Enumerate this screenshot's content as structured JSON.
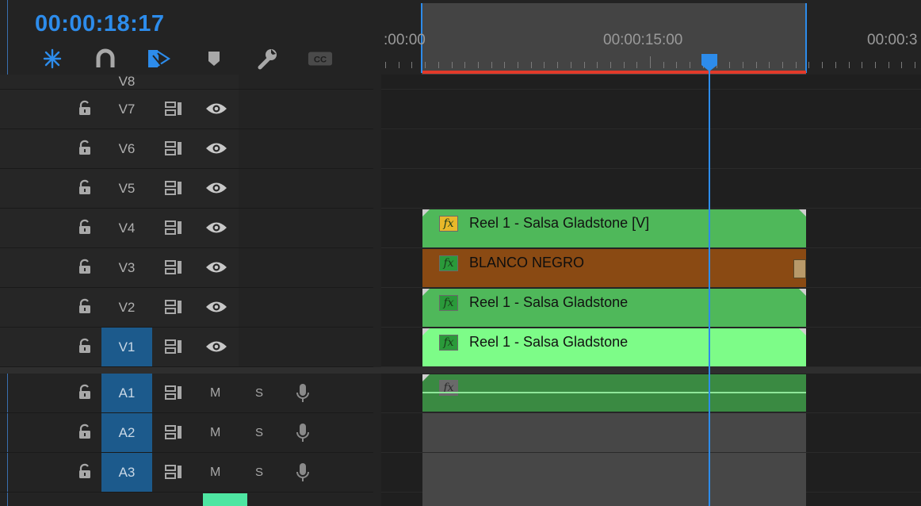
{
  "timecode": "00:00:18:17",
  "toolbar": {
    "icons": [
      "nest-sequence-icon",
      "snap-magnet-icon",
      "linked-selection-icon",
      "add-marker-icon",
      "settings-wrench-icon",
      "captions-icon"
    ],
    "cc_label": "CC"
  },
  "ruler": {
    "labels": [
      ":00:00",
      "00:00:15:00",
      "00:00:3"
    ]
  },
  "tracks": {
    "video": [
      {
        "label": "V8"
      },
      {
        "label": "V7"
      },
      {
        "label": "V6"
      },
      {
        "label": "V5"
      },
      {
        "label": "V4"
      },
      {
        "label": "V3"
      },
      {
        "label": "V2"
      },
      {
        "label": "V1",
        "selected": true
      }
    ],
    "audio": [
      {
        "label": "A1",
        "mute": "M",
        "solo": "S",
        "selected": true
      },
      {
        "label": "A2",
        "mute": "M",
        "solo": "S",
        "selected": true
      },
      {
        "label": "A3",
        "mute": "M",
        "solo": "S",
        "selected": true
      }
    ]
  },
  "clips": {
    "v4": {
      "name": "Reel 1 - Salsa Gladstone [V]",
      "fx": "fx",
      "color": "#4fb85a",
      "fx_color": "#e8b82a"
    },
    "v3": {
      "name": "BLANCO NEGRO",
      "fx": "fx",
      "color": "#8a4a13",
      "fx_color": "#2a9a3a"
    },
    "v2": {
      "name": "Reel 1 - Salsa Gladstone",
      "fx": "fx",
      "color": "#4fb85a",
      "fx_color": "#2a9a3a"
    },
    "v1": {
      "name": "Reel 1 - Salsa Gladstone",
      "fx": "fx",
      "color": "#7dfc88",
      "fx_color": "#2a9a3a"
    },
    "a1": {
      "fx": "fx",
      "color": "#3a8a42"
    }
  },
  "colors": {
    "accent": "#2d8ceb",
    "render_bar": "#e23a2a"
  }
}
